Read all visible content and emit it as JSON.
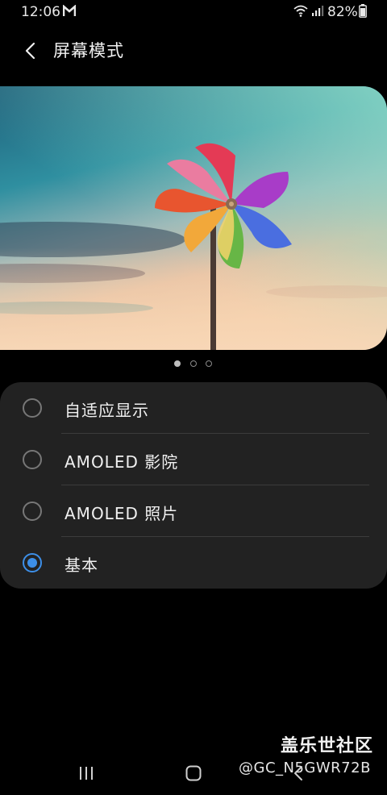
{
  "status_bar": {
    "time": "12:06",
    "battery": "82%",
    "icons": [
      "gmail-icon",
      "wifi-icon",
      "signal-icon",
      "battery-icon"
    ]
  },
  "header": {
    "back_icon": "chevron-left-icon",
    "title": "屏幕模式"
  },
  "preview": {
    "image": "pinwheel-photo",
    "pages": 3,
    "current_page": 1
  },
  "options": {
    "items": [
      {
        "label": "自适应显示",
        "selected": false
      },
      {
        "label": "AMOLED 影院",
        "selected": false
      },
      {
        "label": "AMOLED 照片",
        "selected": false
      },
      {
        "label": "基本",
        "selected": true
      }
    ]
  },
  "watermark": {
    "title": "盖乐世社区",
    "user": "@GC_N5GWR72B"
  },
  "nav_bar": {
    "icons": [
      "recents-icon",
      "home-icon",
      "back-icon"
    ]
  },
  "colors": {
    "background": "#000000",
    "card": "#222222",
    "accent": "#3d8fe8",
    "divider": "#3c3c3c"
  }
}
